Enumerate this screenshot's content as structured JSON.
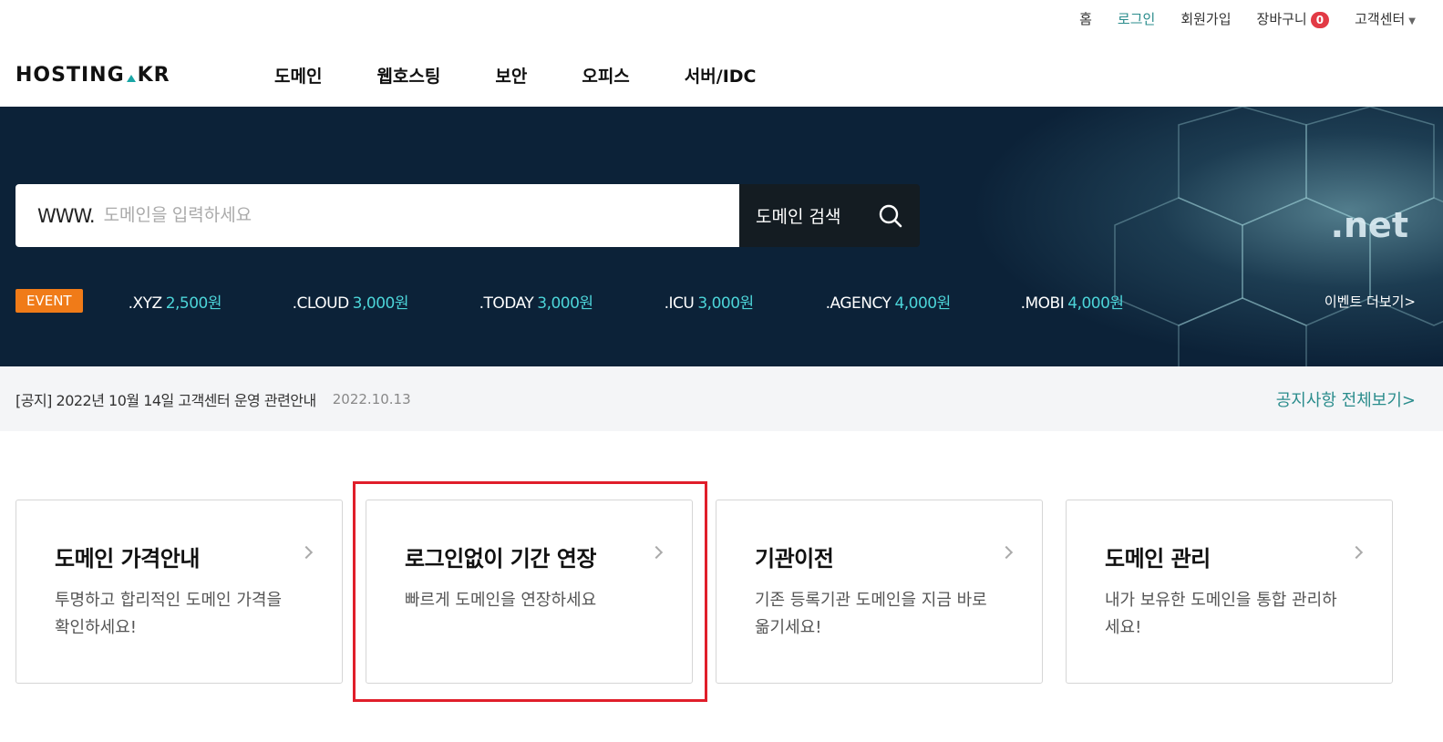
{
  "utility": {
    "home": "홈",
    "login": "로그인",
    "signup": "회원가입",
    "cart": "장바구니",
    "cart_count": "0",
    "support": "고객센터"
  },
  "header": {
    "logo_left": "HOSTING",
    "logo_right": "KR",
    "nav": [
      "도메인",
      "웹호스팅",
      "보안",
      "오피스",
      "서버/IDC"
    ]
  },
  "hero": {
    "www": "WWW.",
    "search_placeholder": "도메인을 입력하세요",
    "search_button": "도메인 검색",
    "promo_tld": ".net",
    "event_badge": "EVENT",
    "tlds": [
      {
        "name": ".XYZ",
        "price": "2,500원"
      },
      {
        "name": ".CLOUD",
        "price": "3,000원"
      },
      {
        "name": ".TODAY",
        "price": "3,000원"
      },
      {
        "name": ".ICU",
        "price": "3,000원"
      },
      {
        "name": ".AGENCY",
        "price": "4,000원"
      },
      {
        "name": ".MOBI",
        "price": "4,000원"
      }
    ],
    "event_more": "이벤트 더보기>"
  },
  "notice": {
    "text": "[공지] 2022년 10월 14일 고객센터 운영 관련안내",
    "date": "2022.10.13",
    "more": "공지사항 전체보기>"
  },
  "cards": [
    {
      "title": "도메인 가격안내",
      "desc": "투명하고 합리적인 도메인 가격을 확인하세요!"
    },
    {
      "title": "로그인없이 기간 연장",
      "desc": "빠르게 도메인을 연장하세요"
    },
    {
      "title": "기관이전",
      "desc": "기존 등록기관 도메인을 지금 바로 옮기세요!"
    },
    {
      "title": "도메인 관리",
      "desc": "내가 보유한 도메인을 통합 관리하세요!"
    }
  ],
  "colors": {
    "accent": "#2a8c8c",
    "hero_bg": "#0c2238",
    "event_orange": "#f07b18",
    "price_cyan": "#4cd4d8",
    "highlight_red": "#e01e2a"
  }
}
